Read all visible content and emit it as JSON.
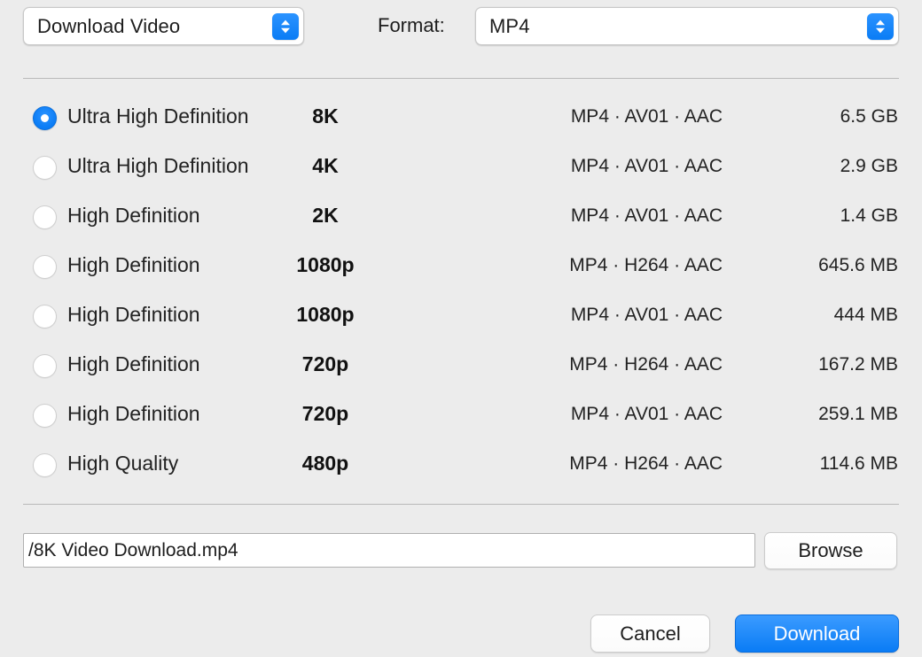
{
  "header": {
    "mode_popup": {
      "value": "Download Video",
      "icon": "up-down-chevron-icon"
    },
    "format_label": "Format:",
    "format_popup": {
      "value": "MP4",
      "icon": "up-down-chevron-icon"
    }
  },
  "options": {
    "rows": [
      {
        "quality": "Ultra High Definition",
        "resolution": "8K",
        "codec": "MP4 · AV01 · AAC",
        "size": "6.5 GB",
        "selected": true
      },
      {
        "quality": "Ultra High Definition",
        "resolution": "4K",
        "codec": "MP4 · AV01 · AAC",
        "size": "2.9 GB",
        "selected": false
      },
      {
        "quality": "High Definition",
        "resolution": "2K",
        "codec": "MP4 · AV01 · AAC",
        "size": "1.4 GB",
        "selected": false
      },
      {
        "quality": "High Definition",
        "resolution": "1080p",
        "codec": "MP4 · H264 · AAC",
        "size": "645.6 MB",
        "selected": false
      },
      {
        "quality": "High Definition",
        "resolution": "1080p",
        "codec": "MP4 · AV01 · AAC",
        "size": "444 MB",
        "selected": false
      },
      {
        "quality": "High Definition",
        "resolution": "720p",
        "codec": "MP4 · H264 · AAC",
        "size": "167.2 MB",
        "selected": false
      },
      {
        "quality": "High Definition",
        "resolution": "720p",
        "codec": "MP4 · AV01 · AAC",
        "size": "259.1 MB",
        "selected": false
      },
      {
        "quality": "High Quality",
        "resolution": "480p",
        "codec": "MP4 · H264 · AAC",
        "size": "114.6 MB",
        "selected": false
      }
    ]
  },
  "destination": {
    "path_value": "/8K Video Download.mp4",
    "browse_label": "Browse"
  },
  "footer": {
    "cancel_label": "Cancel",
    "download_label": "Download"
  },
  "colors": {
    "accent": "#0a7cf5",
    "window_background": "#ececec",
    "divider": "#b9b9b9",
    "text": "#1d1d1d"
  }
}
